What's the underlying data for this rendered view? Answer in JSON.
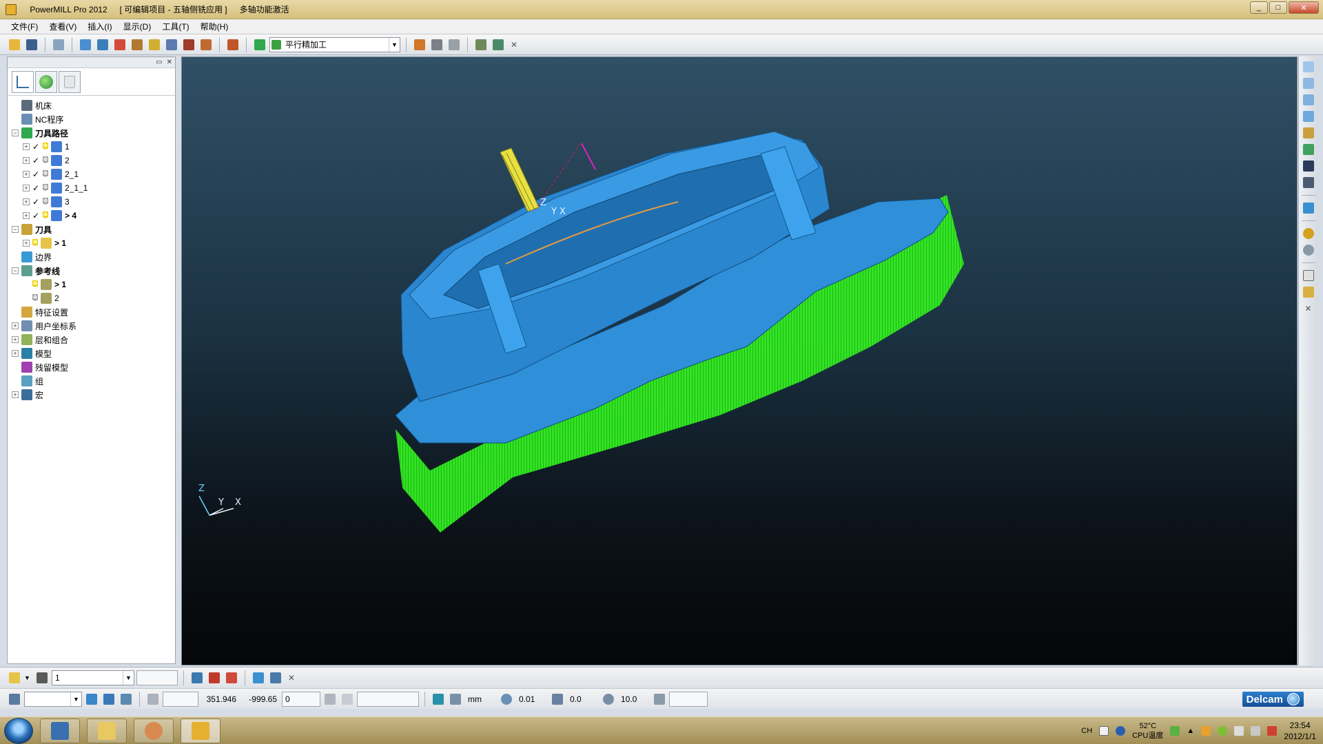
{
  "window": {
    "app_title": "PowerMILL Pro 2012",
    "project": "[ 可编辑项目 - 五轴侧铣应用 ]",
    "extra": "多轴功能激活"
  },
  "menu": [
    {
      "label": "文件(F)"
    },
    {
      "label": "查看(V)"
    },
    {
      "label": "插入(I)"
    },
    {
      "label": "显示(D)"
    },
    {
      "label": "工具(T)"
    },
    {
      "label": "帮助(H)"
    }
  ],
  "toolbar": {
    "strategy_combo": "平行精加工"
  },
  "explorer": {
    "tree": [
      {
        "label": "机床",
        "level": 0,
        "expander": "",
        "icon": "machine-icon",
        "color": "#5b6b7a"
      },
      {
        "label": "NC程序",
        "level": 0,
        "expander": "",
        "icon": "nc-program-icon",
        "color": "#6a8fb5"
      },
      {
        "label": "刀具路径",
        "level": 0,
        "expander": "−",
        "icon": "toolpath-icon",
        "color": "#2fa84f",
        "bold": true
      },
      {
        "label": "1",
        "level": 1,
        "expander": "+",
        "icon": "toolpath-item-icon",
        "check": "✓",
        "bulb": "on",
        "color": "#3f7bd6"
      },
      {
        "label": "2",
        "level": 1,
        "expander": "+",
        "icon": "toolpath-item-icon",
        "check": "✓",
        "bulb": "off",
        "color": "#3f7bd6"
      },
      {
        "label": "2_1",
        "level": 1,
        "expander": "+",
        "icon": "toolpath-item-icon",
        "check": "✓",
        "bulb": "off",
        "color": "#3f7bd6"
      },
      {
        "label": "2_1_1",
        "level": 1,
        "expander": "+",
        "icon": "toolpath-item-icon",
        "check": "✓",
        "bulb": "off",
        "color": "#3f7bd6"
      },
      {
        "label": "3",
        "level": 1,
        "expander": "+",
        "icon": "toolpath-item-icon",
        "check": "✓",
        "bulb": "off",
        "color": "#3f7bd6"
      },
      {
        "label": "> 4",
        "level": 1,
        "expander": "+",
        "icon": "toolpath-item-icon",
        "check": "✓",
        "bulb": "on",
        "color": "#3f7bd6",
        "bold": true
      },
      {
        "label": "刀具",
        "level": 0,
        "expander": "−",
        "icon": "tool-icon",
        "color": "#c8a23a",
        "bold": true
      },
      {
        "label": "> 1",
        "level": 1,
        "expander": "+",
        "icon": "tool-item-icon",
        "bulb": "on",
        "color": "#e6c44a",
        "bold": true
      },
      {
        "label": "边界",
        "level": 0,
        "expander": "",
        "icon": "boundary-icon",
        "color": "#3a9ad6"
      },
      {
        "label": "参考线",
        "level": 0,
        "expander": "−",
        "icon": "pattern-icon",
        "color": "#5d9f8e",
        "bold": true
      },
      {
        "label": "> 1",
        "level": 1,
        "expander": "",
        "icon": "pattern-item-icon",
        "bulb": "on",
        "color": "#a5a060",
        "bold": true
      },
      {
        "label": "2",
        "level": 1,
        "expander": "",
        "icon": "pattern-item-icon",
        "bulb": "off",
        "color": "#a5a060"
      },
      {
        "label": "特征设置",
        "level": 0,
        "expander": "",
        "icon": "feature-icon",
        "color": "#d4a640"
      },
      {
        "label": "用户坐标系",
        "level": 0,
        "expander": "+",
        "icon": "workplane-icon",
        "color": "#6f8fb0"
      },
      {
        "label": "层和组合",
        "level": 0,
        "expander": "+",
        "icon": "layer-icon",
        "color": "#8fb25a"
      },
      {
        "label": "模型",
        "level": 0,
        "expander": "+",
        "icon": "model-icon",
        "color": "#2a7fa8"
      },
      {
        "label": "残留模型",
        "level": 0,
        "expander": "",
        "icon": "stock-model-icon",
        "color": "#a040b0"
      },
      {
        "label": "组",
        "level": 0,
        "expander": "",
        "icon": "group-icon",
        "color": "#5aa0c0"
      },
      {
        "label": "宏",
        "level": 0,
        "expander": "+",
        "icon": "macro-icon",
        "color": "#3a6f9a"
      }
    ]
  },
  "viewport": {
    "axis_labels": {
      "z": "Z",
      "y": "Y",
      "x": "X"
    },
    "model_color": "#2f8fd8",
    "toolpath_color": "#33ee22",
    "tool_color": "#e8e040"
  },
  "bottom_toolbar1": {
    "tool_combo": "1"
  },
  "status": {
    "workplane_combo": "",
    "coord_x": "351.946",
    "coord_y": "-999.65",
    "coord_z": "0",
    "units": "mm",
    "tolerance": "0.01",
    "thickness": "0.0",
    "diameter": "10.0",
    "brand": "Delcam"
  },
  "taskbar": {
    "ime": "CH",
    "cpu_temp": "52°C",
    "cpu_label": "CPU温度",
    "time": "23:54",
    "date": "2012/1/1"
  }
}
